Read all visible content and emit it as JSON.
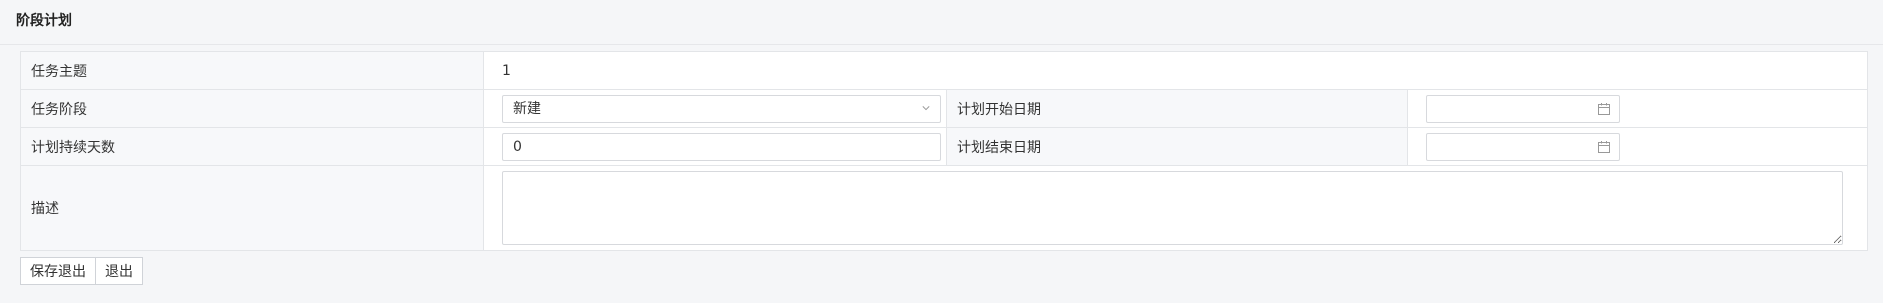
{
  "header": {
    "title": "阶段计划"
  },
  "form": {
    "task_subject": {
      "label": "任务主题",
      "value": "1"
    },
    "task_stage": {
      "label": "任务阶段",
      "selected": "新建"
    },
    "plan_start": {
      "label": "计划开始日期",
      "value": ""
    },
    "plan_duration": {
      "label": "计划持续天数",
      "value": "0"
    },
    "plan_end": {
      "label": "计划结束日期",
      "value": ""
    },
    "description": {
      "label": "描述",
      "value": ""
    }
  },
  "buttons": {
    "save_exit": "保存退出",
    "exit": "退出"
  },
  "icons": {
    "select": "chevron-down-icon",
    "date": "calendar-icon"
  }
}
